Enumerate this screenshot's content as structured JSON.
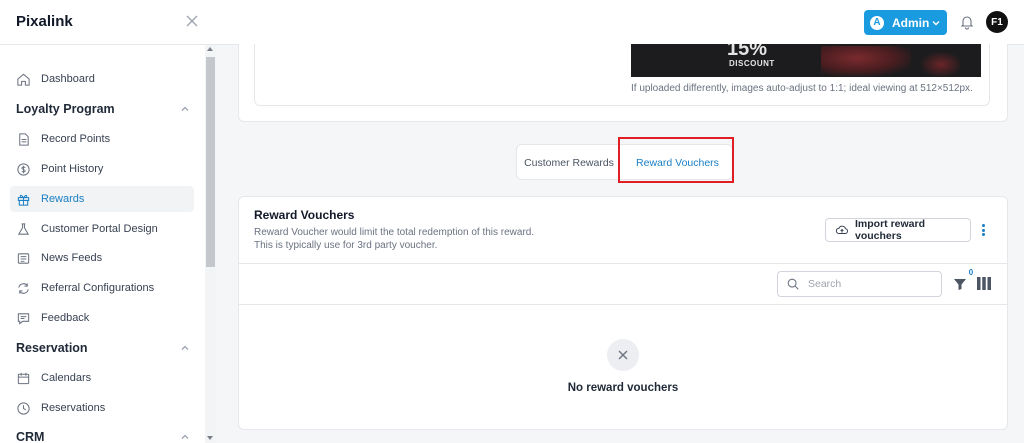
{
  "app": {
    "brand": "Pixalink"
  },
  "header": {
    "admin_initial": "A",
    "admin_label": "Admin",
    "user_initials": "F1"
  },
  "sidebar": {
    "items": [
      {
        "label": "Dashboard",
        "icon": "home-icon"
      },
      {
        "label": "Record Points",
        "icon": "document-icon"
      },
      {
        "label": "Point History",
        "icon": "dollar-icon"
      },
      {
        "label": "Rewards",
        "icon": "gift-icon",
        "active": true
      },
      {
        "label": "Customer Portal Design",
        "icon": "flask-icon"
      },
      {
        "label": "News Feeds",
        "icon": "news-icon"
      },
      {
        "label": "Referral Configurations",
        "icon": "refresh-icon"
      },
      {
        "label": "Feedback",
        "icon": "message-icon"
      },
      {
        "label": "Calendars",
        "icon": "calendar-icon"
      },
      {
        "label": "Reservations",
        "icon": "clock-icon"
      }
    ],
    "sections": {
      "loyalty": "Loyalty Program",
      "reservation": "Reservation",
      "crm": "CRM"
    }
  },
  "upload": {
    "banner_percent": "15%",
    "banner_label": "DISCOUNT",
    "hint": "If uploaded differently, images auto-adjust to 1:1; ideal viewing at 512×512px."
  },
  "tabs": [
    {
      "label": "Customer Rewards"
    },
    {
      "label": "Reward Vouchers",
      "active": true
    }
  ],
  "vouchers": {
    "title": "Reward Vouchers",
    "desc_line1": "Reward Voucher would limit the total redemption of this reward.",
    "desc_line2": "This is typically use for 3rd party voucher.",
    "import_label": "Import reward vouchers",
    "search_placeholder": "Search",
    "filter_count": "0",
    "empty_text": "No reward vouchers"
  },
  "colors": {
    "accent": "#1a9be0",
    "active_text": "#1a7fc4",
    "highlight": "#e01e26"
  }
}
